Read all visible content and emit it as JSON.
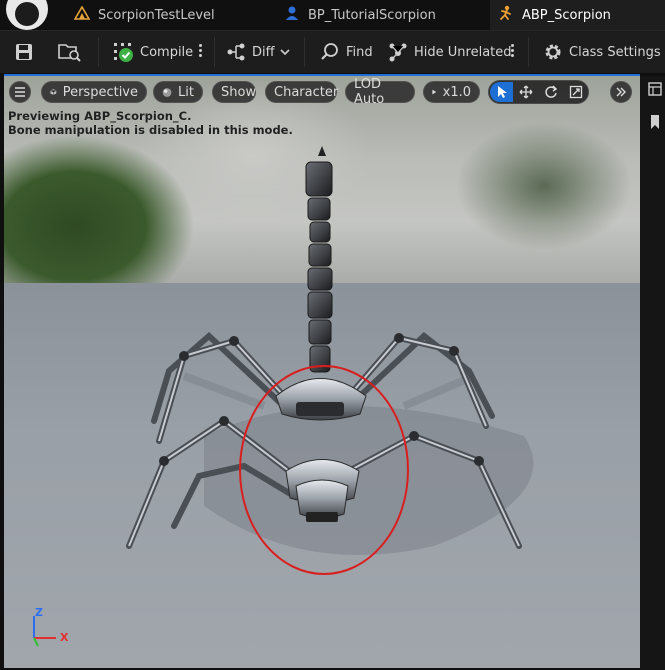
{
  "tabs": [
    {
      "label": "ScorpionTestLevel",
      "icon": "level-icon"
    },
    {
      "label": "BP_TutorialScorpion",
      "icon": "blueprint-person-icon"
    },
    {
      "label": "ABP_Scorpion",
      "icon": "animation-blueprint-icon",
      "active": true
    }
  ],
  "toolbar": {
    "compile": "Compile",
    "diff": "Diff",
    "find": "Find",
    "hide_unrelated": "Hide Unrelated",
    "class_settings": "Class Settings"
  },
  "viewport": {
    "perspective": "Perspective",
    "lit": "Lit",
    "show": "Show",
    "character": "Character",
    "lod": "LOD Auto",
    "speed": "x1.0",
    "preview_line1": "Previewing ABP_Scorpion_C.",
    "preview_line2": "Bone manipulation is disabled in this mode.",
    "axis_z": "Z",
    "axis_x": "X"
  },
  "colors": {
    "accent": "#1e6fd4",
    "highlight_circle": "#d81f1f",
    "compile_ok": "#3cb043"
  }
}
